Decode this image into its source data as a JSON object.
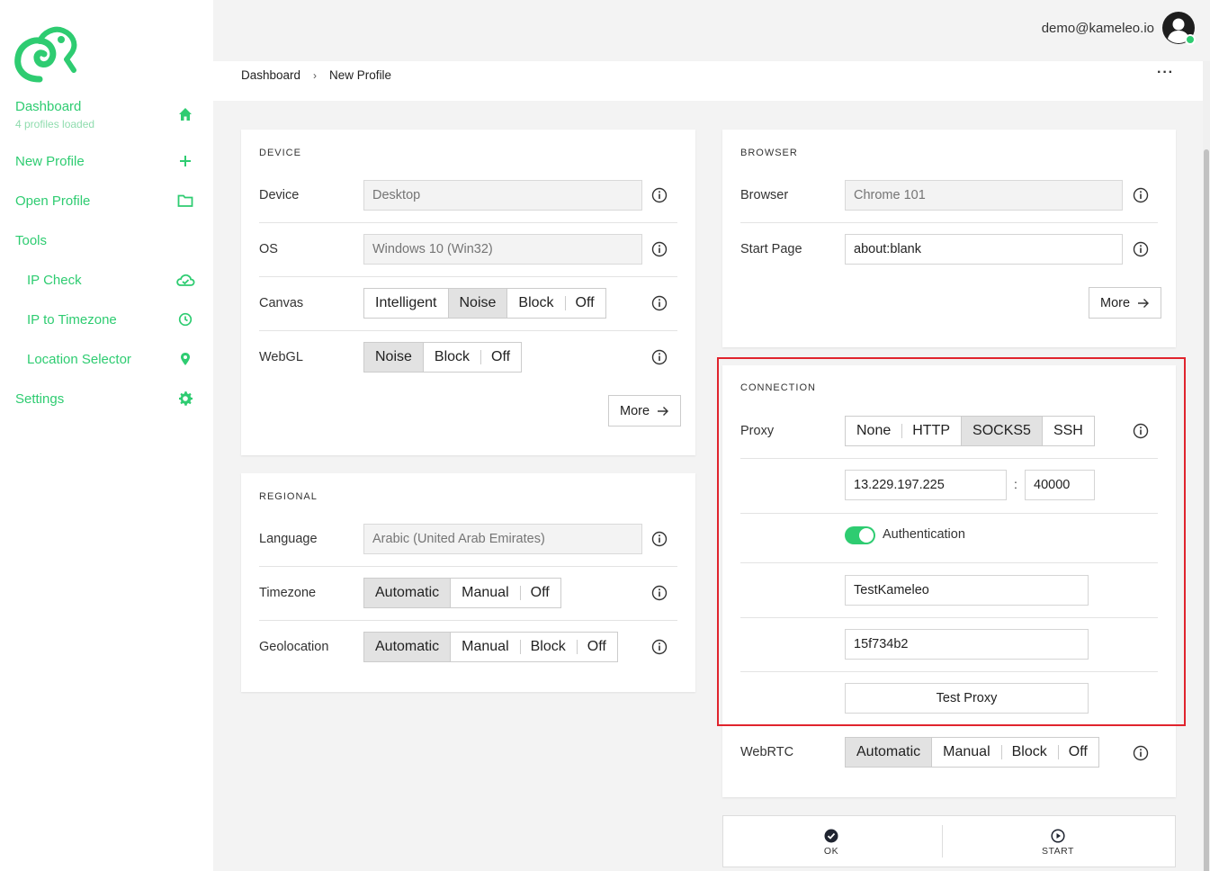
{
  "brand": {
    "accent": "#2ecc71",
    "highlight": "#e0242d"
  },
  "user": {
    "email": "demo@kameleo.io"
  },
  "sidebar": {
    "dashboard": {
      "label": "Dashboard",
      "caption": "4 profiles loaded"
    },
    "new_profile": "New Profile",
    "open_profile": "Open Profile",
    "tools": "Tools",
    "ip_check": "IP Check",
    "ip_to_timezone": "IP to Timezone",
    "location_selector": "Location Selector",
    "settings": "Settings"
  },
  "breadcrumb": {
    "root": "Dashboard",
    "current": "New Profile"
  },
  "device": {
    "title": "DEVICE",
    "device_label": "Device",
    "device_placeholder": "Desktop",
    "os_label": "OS",
    "os_placeholder": "Windows 10 (Win32)",
    "canvas_label": "Canvas",
    "canvas_options": [
      "Intelligent",
      "Noise",
      "Block",
      "Off"
    ],
    "canvas_selected": "Noise",
    "webgl_label": "WebGL",
    "webgl_options": [
      "Noise",
      "Block",
      "Off"
    ],
    "webgl_selected": "Noise",
    "more": "More"
  },
  "regional": {
    "title": "REGIONAL",
    "language_label": "Language",
    "language_placeholder": "Arabic (United Arab Emirates)",
    "timezone_label": "Timezone",
    "timezone_options": [
      "Automatic",
      "Manual",
      "Off"
    ],
    "timezone_selected": "Automatic",
    "geolocation_label": "Geolocation",
    "geolocation_options": [
      "Automatic",
      "Manual",
      "Block",
      "Off"
    ],
    "geolocation_selected": "Automatic"
  },
  "browser": {
    "title": "BROWSER",
    "browser_label": "Browser",
    "browser_placeholder": "Chrome 101",
    "start_page_label": "Start Page",
    "start_page_value": "about:blank",
    "more": "More"
  },
  "connection": {
    "title": "CONNECTION",
    "proxy_label": "Proxy",
    "proxy_options": [
      "None",
      "HTTP",
      "SOCKS5",
      "SSH"
    ],
    "proxy_selected": "SOCKS5",
    "host": "13.229.197.225",
    "separator": ":",
    "port": "40000",
    "auth_label": "Authentication",
    "auth_enabled": true,
    "username": "TestKameleo",
    "password": "15f734b2",
    "test_proxy": "Test Proxy",
    "webrtc_label": "WebRTC",
    "webrtc_options": [
      "Automatic",
      "Manual",
      "Block",
      "Off"
    ],
    "webrtc_selected": "Automatic"
  },
  "actions": {
    "ok": "OK",
    "start": "START"
  }
}
